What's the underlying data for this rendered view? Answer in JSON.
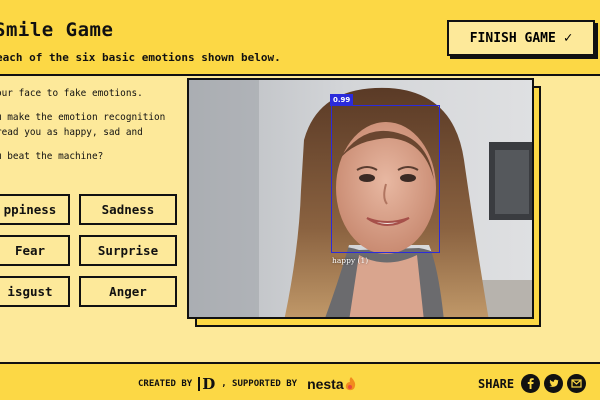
{
  "header": {
    "title": "Smile Game",
    "subtitle": "each of the six basic emotions shown below.",
    "finish_button": "FINISH GAME",
    "finish_icon": "checkmark-icon"
  },
  "instructions": [
    "our face to fake emotions.",
    "u make the emotion recognition\nread you as happy, sad and",
    "u beat the machine?"
  ],
  "emotions": {
    "happiness": "ppiness",
    "sadness": "Sadness",
    "fear": "Fear",
    "surprise": "Surprise",
    "disgust": "isgust",
    "anger": "Anger"
  },
  "detection": {
    "score": "0.99",
    "label": "happy (1)",
    "box_color": "#2b2bdb"
  },
  "footer": {
    "created_by": "CREATED BY",
    "created_logo": "D",
    "supported_by": ", SUPPORTED BY",
    "supporter": "nesta",
    "share_label": "SHARE",
    "share_icons": [
      "facebook-icon",
      "twitter-icon",
      "email-icon"
    ]
  },
  "colors": {
    "header_bg": "#fcd845",
    "page_bg": "#fde99a",
    "ink": "#111111"
  }
}
